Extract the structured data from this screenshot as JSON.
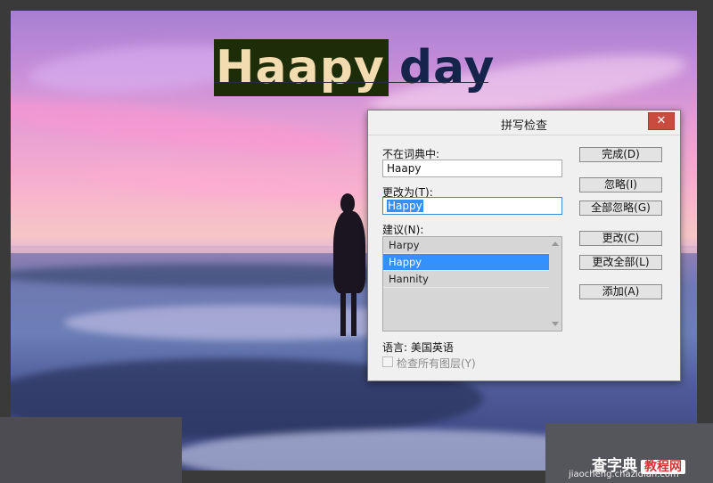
{
  "canvas": {
    "text_misspelled": "Haapy",
    "text_rest": "day"
  },
  "dialog": {
    "title": "拼写检查",
    "close_label": "✕",
    "not_in_dictionary_label": "不在词典中:",
    "not_in_dictionary_value": "Haapy",
    "change_to_label": "更改为(T):",
    "change_to_value": "Happy",
    "suggestions_label": "建议(N):",
    "suggestions": [
      "Harpy",
      "Happy",
      "Hannity"
    ],
    "selected_suggestion": "Happy",
    "language_label": "语言: 美国英语",
    "check_all_layers_label": "检查所有图层(Y)",
    "check_all_layers_checked": false,
    "buttons": {
      "done": "完成(D)",
      "ignore": "忽略(I)",
      "ignore_all": "全部忽略(G)",
      "change": "更改(C)",
      "change_all": "更改全部(L)",
      "add": "添加(A)"
    }
  },
  "watermark": {
    "brand_part1": "查字典",
    "brand_part2": "教程网",
    "url": "jiaocheng.chazidian.com"
  },
  "colors": {
    "selection_blue": "#3390ff",
    "close_red": "#c94a3f",
    "highlight_green": "#1d2d08"
  }
}
